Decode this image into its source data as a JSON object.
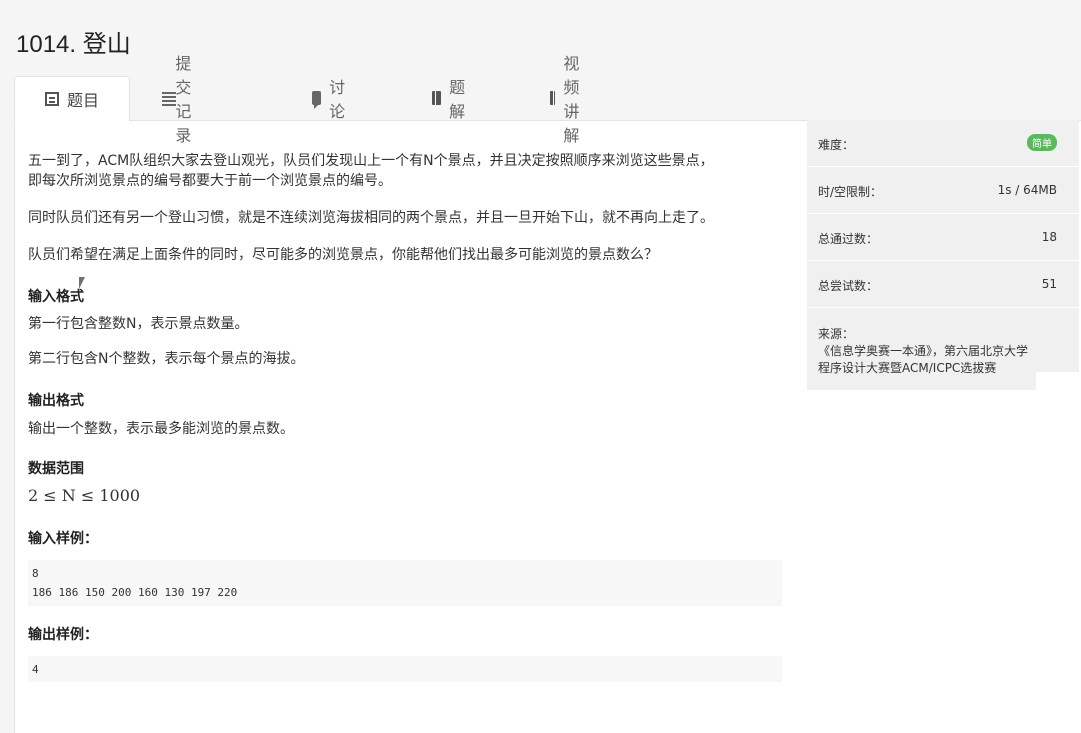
{
  "page": {
    "title": "1014. 登山"
  },
  "tabs": [
    {
      "label": "题目",
      "icon": "document-icon"
    },
    {
      "label": "提交记录",
      "icon": "list-icon"
    },
    {
      "label": "讨论",
      "icon": "comment-icon"
    },
    {
      "label": "题解",
      "icon": "book-icon"
    },
    {
      "label": "视频讲解",
      "icon": "book-icon"
    }
  ],
  "problem": {
    "para1_line1": "五一到了，ACM队组织大家去登山观光，队员们发现山上一个有N个景点，并且决定按照顺序来浏览这些景点，",
    "para1_line2": "即每次所浏览景点的编号都要大于前一个浏览景点的编号。",
    "para2": "同时队员们还有另一个登山习惯，就是不连续浏览海拔相同的两个景点，并且一旦开始下山，就不再向上走了。",
    "para3": "队员们希望在满足上面条件的同时，尽可能多的浏览景点，你能帮他们找出最多可能浏览的景点数么？",
    "input_title": "输入格式",
    "input_line1": "第一行包含整数N，表示景点数量。",
    "input_line2": "第二行包含N个整数，表示每个景点的海拔。",
    "output_title": "输出格式",
    "output_line": "输出一个整数，表示最多能浏览的景点数。",
    "range_title": "数据范围",
    "range_text": "2 ≤ N ≤ 1000",
    "sample_in_title": "输入样例：",
    "sample_in_line1": "8",
    "sample_in_line2": "186 186 150 200 160 130 197 220",
    "sample_out_title": "输出样例：",
    "sample_out_line1": "4"
  },
  "sidebar": {
    "difficulty_label": "难度：",
    "difficulty_value": "简单",
    "limit_label": "时/空限制：",
    "limit_value": "1s / 64MB",
    "passed_label": "总通过数：",
    "passed_value": "18",
    "tried_label": "总尝试数：",
    "tried_value": "51",
    "source_label": "来源：",
    "source_line1": "《信息学奥赛一本通》，第六届北京大学",
    "source_line2": "程序设计大赛暨ACM/ICPC选拔赛"
  },
  "colors": {
    "badge": "#5cb85c",
    "sidebar_bg": "#f0f0f0",
    "code_bg": "#f7f7f7"
  }
}
